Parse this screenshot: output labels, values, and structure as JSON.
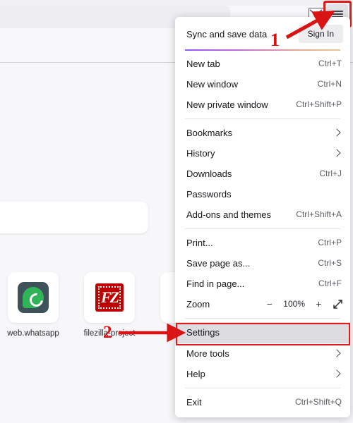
{
  "browser": {
    "toolbar": {
      "extension_icon": "envelope-icon",
      "menu_button": "hamburger-menu-icon"
    }
  },
  "newtab": {
    "shortcuts": [
      {
        "label": "web.whatsapp",
        "icon": "whatsapp-icon"
      },
      {
        "label": "filezilla-project",
        "icon": "filezilla-icon"
      },
      {
        "label": "",
        "icon": "generic-site-icon"
      }
    ]
  },
  "menu": {
    "sync": {
      "label": "Sync and save data",
      "sign_in_label": "Sign In"
    },
    "groups": [
      {
        "items": [
          {
            "label": "New tab",
            "shortcut": "Ctrl+T",
            "type": "item"
          },
          {
            "label": "New window",
            "shortcut": "Ctrl+N",
            "type": "item"
          },
          {
            "label": "New private window",
            "shortcut": "Ctrl+Shift+P",
            "type": "item"
          }
        ]
      },
      {
        "items": [
          {
            "label": "Bookmarks",
            "shortcut": "",
            "type": "submenu"
          },
          {
            "label": "History",
            "shortcut": "",
            "type": "submenu"
          },
          {
            "label": "Downloads",
            "shortcut": "Ctrl+J",
            "type": "item"
          },
          {
            "label": "Passwords",
            "shortcut": "",
            "type": "item"
          },
          {
            "label": "Add-ons and themes",
            "shortcut": "Ctrl+Shift+A",
            "type": "item"
          }
        ]
      },
      {
        "items": [
          {
            "label": "Print...",
            "shortcut": "Ctrl+P",
            "type": "item"
          },
          {
            "label": "Save page as...",
            "shortcut": "Ctrl+S",
            "type": "item"
          },
          {
            "label": "Find in page...",
            "shortcut": "Ctrl+F",
            "type": "item"
          }
        ]
      }
    ],
    "zoom": {
      "label": "Zoom",
      "decrease_label": "−",
      "level": "100%",
      "increase_label": "+",
      "fullscreen_icon": "fullscreen-icon"
    },
    "settings": {
      "label": "Settings"
    },
    "more_tools": {
      "label": "More tools"
    },
    "help": {
      "label": "Help"
    },
    "exit": {
      "label": "Exit",
      "shortcut": "Ctrl+Shift+Q"
    }
  },
  "annotations": {
    "step1": "1",
    "step2": "2",
    "color": "#d81414"
  }
}
